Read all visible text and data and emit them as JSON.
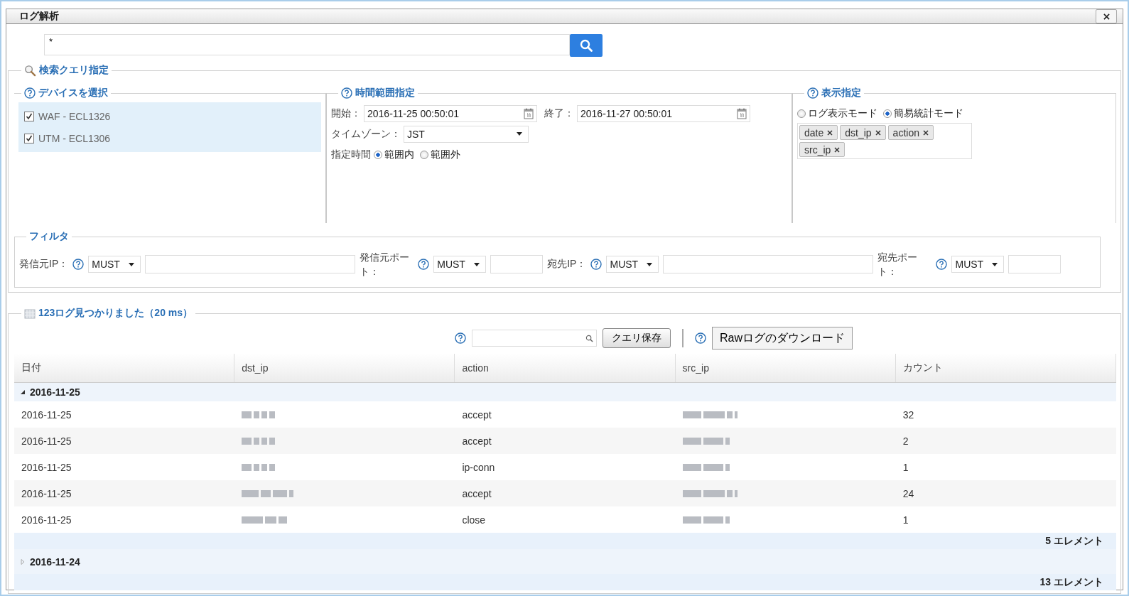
{
  "window": {
    "title": "ログ解析"
  },
  "query": {
    "value": "*"
  },
  "search_section": {
    "title": "検索クエリ指定",
    "devices": {
      "title": "デバイスを選択",
      "items": [
        {
          "label": "WAF - ECL1326",
          "checked": true
        },
        {
          "label": "UTM - ECL1306",
          "checked": true
        }
      ]
    },
    "time_range": {
      "title": "時間範囲指定",
      "start_label": "開始：",
      "start_value": "2016-11-25 00:50:01",
      "end_label": "終了：",
      "end_value": "2016-11-27 00:50:01",
      "timezone_label": "タイムゾーン：",
      "timezone_value": "JST",
      "period_label": "指定時間",
      "options": [
        {
          "label": "範囲内",
          "selected": true
        },
        {
          "label": "範囲外",
          "selected": false
        }
      ]
    },
    "display": {
      "title": "表示指定",
      "modes": [
        {
          "label": "ログ表示モード",
          "selected": false
        },
        {
          "label": "簡易統計モード",
          "selected": true
        }
      ],
      "tags": [
        {
          "label": "date"
        },
        {
          "label": "dst_ip"
        },
        {
          "label": "action"
        },
        {
          "label": "src_ip"
        }
      ]
    },
    "filter": {
      "title": "フィルタ",
      "fields": [
        {
          "label": "発信元IP：",
          "operator": "MUST",
          "kind": "ip"
        },
        {
          "label": "発信元ポート：",
          "operator": "MUST",
          "kind": "port"
        },
        {
          "label": "宛先IP：",
          "operator": "MUST",
          "kind": "ip"
        },
        {
          "label": "宛先ポート：",
          "operator": "MUST",
          "kind": "port"
        }
      ]
    }
  },
  "results": {
    "title": "123ログ見つかりました（20 ms）",
    "save_button": "クエリ保存",
    "download_button": "Rawログのダウンロード",
    "columns": [
      "日付",
      "dst_ip",
      "action",
      "src_ip",
      "カウント"
    ],
    "groups": [
      {
        "label": "2016-11-25",
        "expanded": true,
        "footer": "5 エレメント",
        "rows": [
          {
            "date": "2016-11-25",
            "action": "accept",
            "count": "32"
          },
          {
            "date": "2016-11-25",
            "action": "accept",
            "count": "2"
          },
          {
            "date": "2016-11-25",
            "action": "ip-conn",
            "count": "1"
          },
          {
            "date": "2016-11-25",
            "action": "accept",
            "count": "24"
          },
          {
            "date": "2016-11-25",
            "action": "close",
            "count": "1"
          }
        ]
      },
      {
        "label": "2016-11-24",
        "expanded": false,
        "footer": "13 エレメント"
      }
    ]
  }
}
